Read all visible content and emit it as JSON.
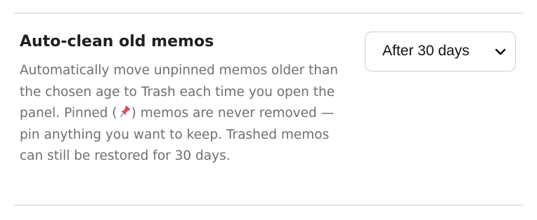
{
  "setting": {
    "title": "Auto-clean old memos",
    "description_before_pin": "Automatically move unpinned memos older than the chosen age to Trash each time you open the panel. Pinned (",
    "pin_icon": "pushpin-icon",
    "description_after_pin": ") memos are never removed — pin anything you want to keep. Trashed memos can still be restored for 30 days.",
    "select": {
      "selected": "After 30 days",
      "icon": "chevron-down-icon"
    }
  },
  "colors": {
    "title": "#1f1f1f",
    "description": "#6f6f6f",
    "divider": "#e3e3e3",
    "select_border": "#cfcfcf",
    "pin": "#d8344f"
  }
}
